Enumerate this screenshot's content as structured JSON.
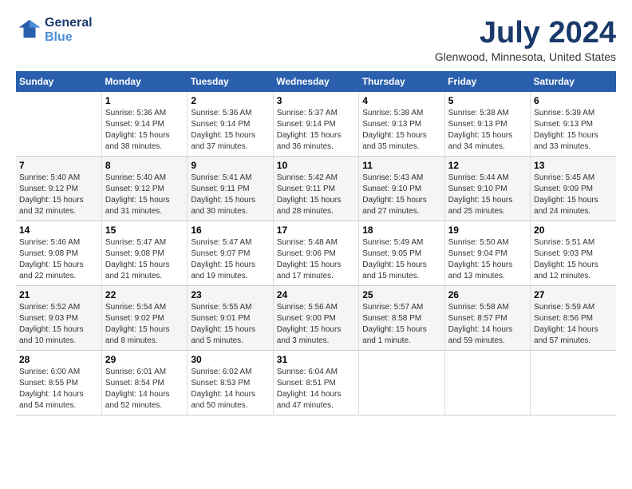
{
  "header": {
    "logo_line1": "General",
    "logo_line2": "Blue",
    "month_title": "July 2024",
    "location": "Glenwood, Minnesota, United States"
  },
  "calendar": {
    "days_of_week": [
      "Sunday",
      "Monday",
      "Tuesday",
      "Wednesday",
      "Thursday",
      "Friday",
      "Saturday"
    ],
    "weeks": [
      [
        {
          "day": "",
          "info": ""
        },
        {
          "day": "1",
          "info": "Sunrise: 5:36 AM\nSunset: 9:14 PM\nDaylight: 15 hours\nand 38 minutes."
        },
        {
          "day": "2",
          "info": "Sunrise: 5:36 AM\nSunset: 9:14 PM\nDaylight: 15 hours\nand 37 minutes."
        },
        {
          "day": "3",
          "info": "Sunrise: 5:37 AM\nSunset: 9:14 PM\nDaylight: 15 hours\nand 36 minutes."
        },
        {
          "day": "4",
          "info": "Sunrise: 5:38 AM\nSunset: 9:13 PM\nDaylight: 15 hours\nand 35 minutes."
        },
        {
          "day": "5",
          "info": "Sunrise: 5:38 AM\nSunset: 9:13 PM\nDaylight: 15 hours\nand 34 minutes."
        },
        {
          "day": "6",
          "info": "Sunrise: 5:39 AM\nSunset: 9:13 PM\nDaylight: 15 hours\nand 33 minutes."
        }
      ],
      [
        {
          "day": "7",
          "info": "Sunrise: 5:40 AM\nSunset: 9:12 PM\nDaylight: 15 hours\nand 32 minutes."
        },
        {
          "day": "8",
          "info": "Sunrise: 5:40 AM\nSunset: 9:12 PM\nDaylight: 15 hours\nand 31 minutes."
        },
        {
          "day": "9",
          "info": "Sunrise: 5:41 AM\nSunset: 9:11 PM\nDaylight: 15 hours\nand 30 minutes."
        },
        {
          "day": "10",
          "info": "Sunrise: 5:42 AM\nSunset: 9:11 PM\nDaylight: 15 hours\nand 28 minutes."
        },
        {
          "day": "11",
          "info": "Sunrise: 5:43 AM\nSunset: 9:10 PM\nDaylight: 15 hours\nand 27 minutes."
        },
        {
          "day": "12",
          "info": "Sunrise: 5:44 AM\nSunset: 9:10 PM\nDaylight: 15 hours\nand 25 minutes."
        },
        {
          "day": "13",
          "info": "Sunrise: 5:45 AM\nSunset: 9:09 PM\nDaylight: 15 hours\nand 24 minutes."
        }
      ],
      [
        {
          "day": "14",
          "info": "Sunrise: 5:46 AM\nSunset: 9:08 PM\nDaylight: 15 hours\nand 22 minutes."
        },
        {
          "day": "15",
          "info": "Sunrise: 5:47 AM\nSunset: 9:08 PM\nDaylight: 15 hours\nand 21 minutes."
        },
        {
          "day": "16",
          "info": "Sunrise: 5:47 AM\nSunset: 9:07 PM\nDaylight: 15 hours\nand 19 minutes."
        },
        {
          "day": "17",
          "info": "Sunrise: 5:48 AM\nSunset: 9:06 PM\nDaylight: 15 hours\nand 17 minutes."
        },
        {
          "day": "18",
          "info": "Sunrise: 5:49 AM\nSunset: 9:05 PM\nDaylight: 15 hours\nand 15 minutes."
        },
        {
          "day": "19",
          "info": "Sunrise: 5:50 AM\nSunset: 9:04 PM\nDaylight: 15 hours\nand 13 minutes."
        },
        {
          "day": "20",
          "info": "Sunrise: 5:51 AM\nSunset: 9:03 PM\nDaylight: 15 hours\nand 12 minutes."
        }
      ],
      [
        {
          "day": "21",
          "info": "Sunrise: 5:52 AM\nSunset: 9:03 PM\nDaylight: 15 hours\nand 10 minutes."
        },
        {
          "day": "22",
          "info": "Sunrise: 5:54 AM\nSunset: 9:02 PM\nDaylight: 15 hours\nand 8 minutes."
        },
        {
          "day": "23",
          "info": "Sunrise: 5:55 AM\nSunset: 9:01 PM\nDaylight: 15 hours\nand 5 minutes."
        },
        {
          "day": "24",
          "info": "Sunrise: 5:56 AM\nSunset: 9:00 PM\nDaylight: 15 hours\nand 3 minutes."
        },
        {
          "day": "25",
          "info": "Sunrise: 5:57 AM\nSunset: 8:58 PM\nDaylight: 15 hours\nand 1 minute."
        },
        {
          "day": "26",
          "info": "Sunrise: 5:58 AM\nSunset: 8:57 PM\nDaylight: 14 hours\nand 59 minutes."
        },
        {
          "day": "27",
          "info": "Sunrise: 5:59 AM\nSunset: 8:56 PM\nDaylight: 14 hours\nand 57 minutes."
        }
      ],
      [
        {
          "day": "28",
          "info": "Sunrise: 6:00 AM\nSunset: 8:55 PM\nDaylight: 14 hours\nand 54 minutes."
        },
        {
          "day": "29",
          "info": "Sunrise: 6:01 AM\nSunset: 8:54 PM\nDaylight: 14 hours\nand 52 minutes."
        },
        {
          "day": "30",
          "info": "Sunrise: 6:02 AM\nSunset: 8:53 PM\nDaylight: 14 hours\nand 50 minutes."
        },
        {
          "day": "31",
          "info": "Sunrise: 6:04 AM\nSunset: 8:51 PM\nDaylight: 14 hours\nand 47 minutes."
        },
        {
          "day": "",
          "info": ""
        },
        {
          "day": "",
          "info": ""
        },
        {
          "day": "",
          "info": ""
        }
      ]
    ]
  }
}
